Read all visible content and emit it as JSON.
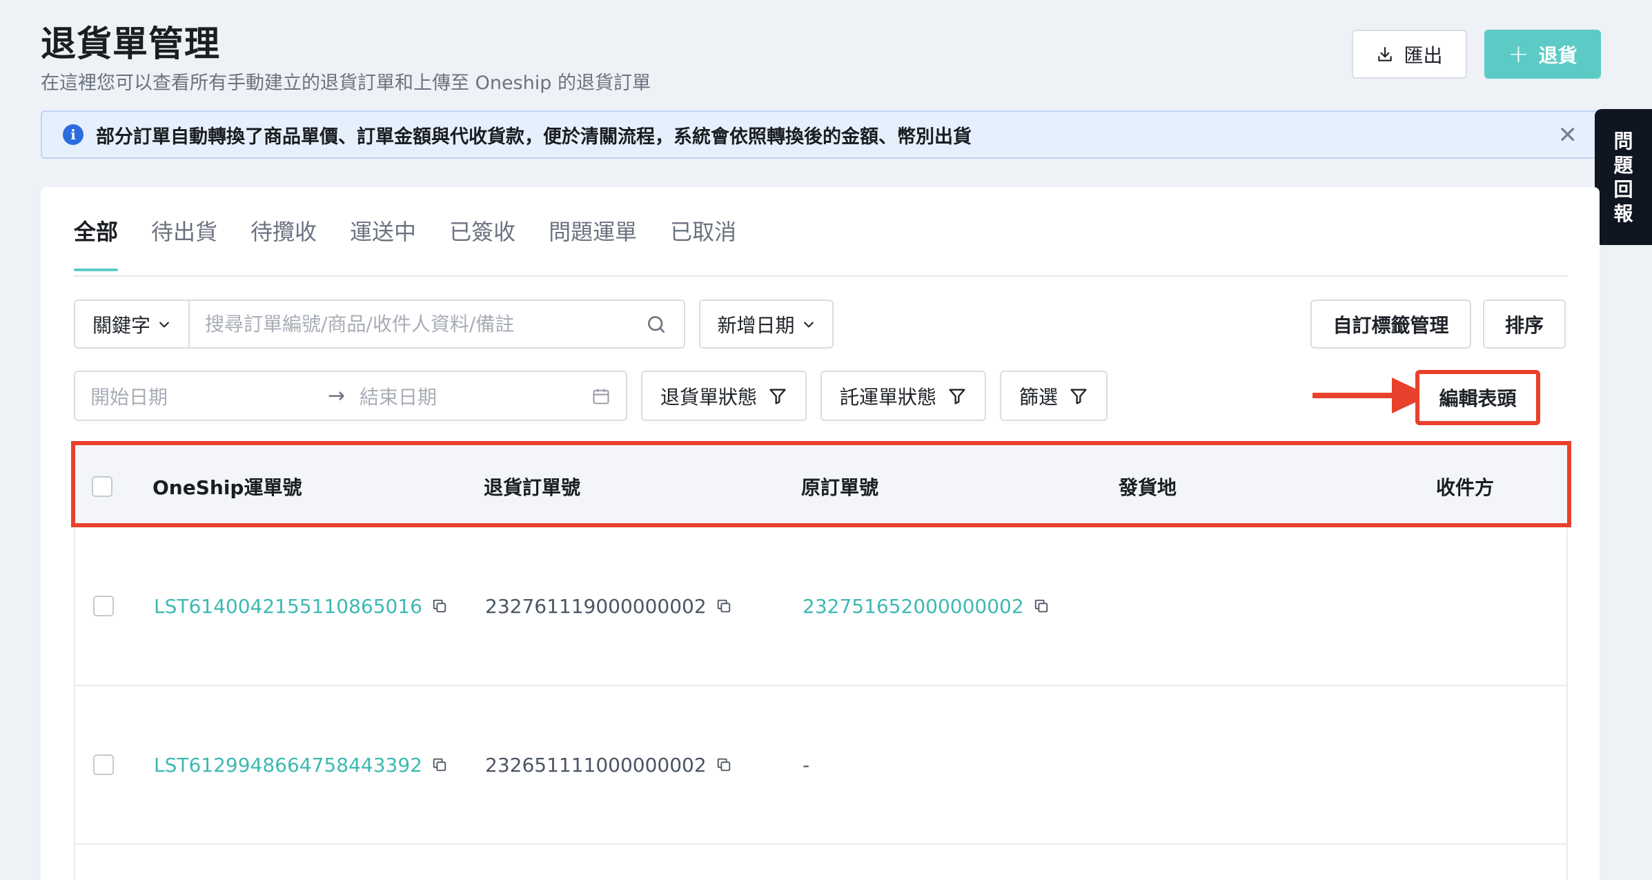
{
  "header": {
    "title": "退貨單管理",
    "subtitle": "在這裡您可以查看所有手動建立的退貨訂單和上傳至 Oneship 的退貨訂單",
    "export_label": "匯出",
    "return_label": "退貨"
  },
  "banner": {
    "text": "部分訂單自動轉換了商品單價、訂單金額與代收貨款，便於清關流程，系統會依照轉換後的金額、幣別出貨"
  },
  "feedback": {
    "chars": [
      "問",
      "題",
      "回",
      "報"
    ]
  },
  "tabs": [
    {
      "label": "全部"
    },
    {
      "label": "待出貨"
    },
    {
      "label": "待攬收"
    },
    {
      "label": "運送中"
    },
    {
      "label": "已簽收"
    },
    {
      "label": "問題運單"
    },
    {
      "label": "已取消"
    }
  ],
  "filters": {
    "keyword_select": "關鍵字",
    "search_placeholder": "搜尋訂單編號/商品/收件人資料/備註",
    "date_select": "新增日期",
    "tag_manage": "自訂標籤管理",
    "sort": "排序",
    "start_date": "開始日期",
    "end_date": "結束日期",
    "return_status": "退貨單狀態",
    "shipment_status": "託運單狀態",
    "filter": "篩選",
    "edit_header": "編輯表頭"
  },
  "table": {
    "columns": [
      "OneShip運單號",
      "退貨訂單號",
      "原訂單號",
      "發貨地",
      "收件方"
    ],
    "rows": [
      {
        "oneship_no": "LST6140042155110865016",
        "return_no": "232761119000000002",
        "original_no": "232751652000000002",
        "origin": "",
        "recipient": ""
      },
      {
        "oneship_no": "LST6129948664758443392",
        "return_no": "232651111000000002",
        "original_no": "-",
        "origin": "",
        "recipient": ""
      }
    ]
  },
  "colors": {
    "accent": "#5ccbc6",
    "link": "#3db9b2",
    "highlight": "#e8412c",
    "info": "#2b6de0"
  }
}
